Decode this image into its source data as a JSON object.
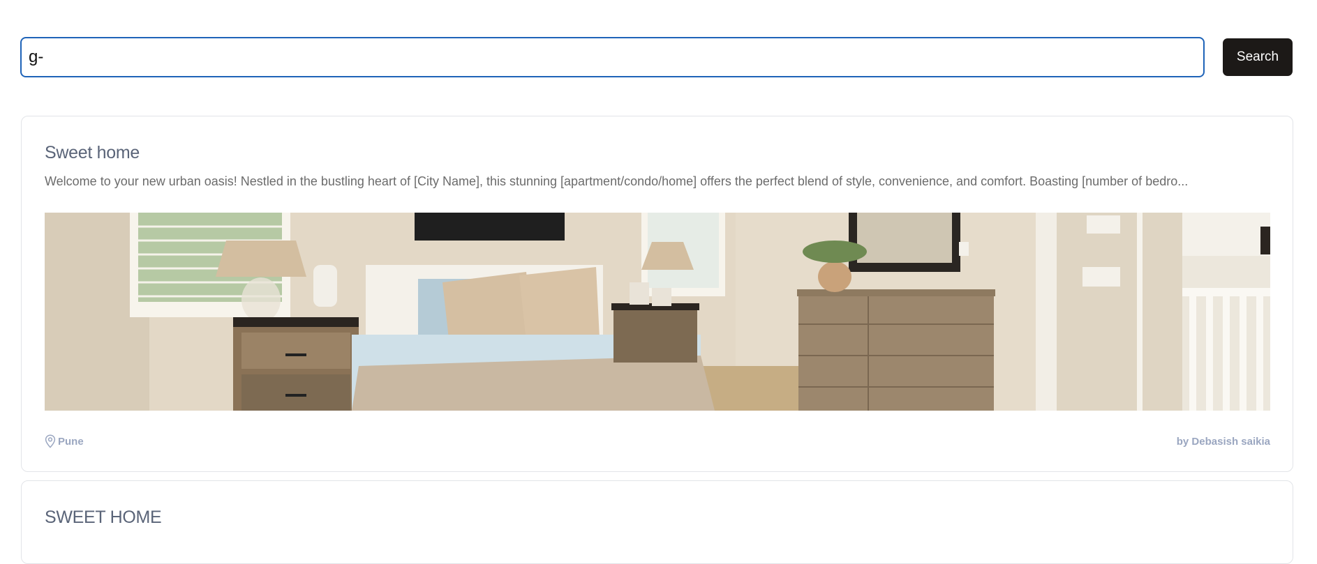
{
  "search": {
    "value": "g-",
    "button_label": "Search"
  },
  "listings": [
    {
      "title": "Sweet home",
      "description": "Welcome to your new urban oasis! Nestled in the bustling heart of [City Name], this stunning [apartment/condo/home] offers the perfect blend of style, convenience, and comfort. Boasting [number of bedro...",
      "location": "Pune",
      "author": "by Debasish saikia",
      "location_icon": "map-pin-icon"
    },
    {
      "title": "SWEET HOME"
    }
  ],
  "colors": {
    "accent_border": "#1e63b8",
    "button_bg": "#1c1917",
    "title_text": "#5a6478",
    "meta_text": "#9aa6c0"
  }
}
